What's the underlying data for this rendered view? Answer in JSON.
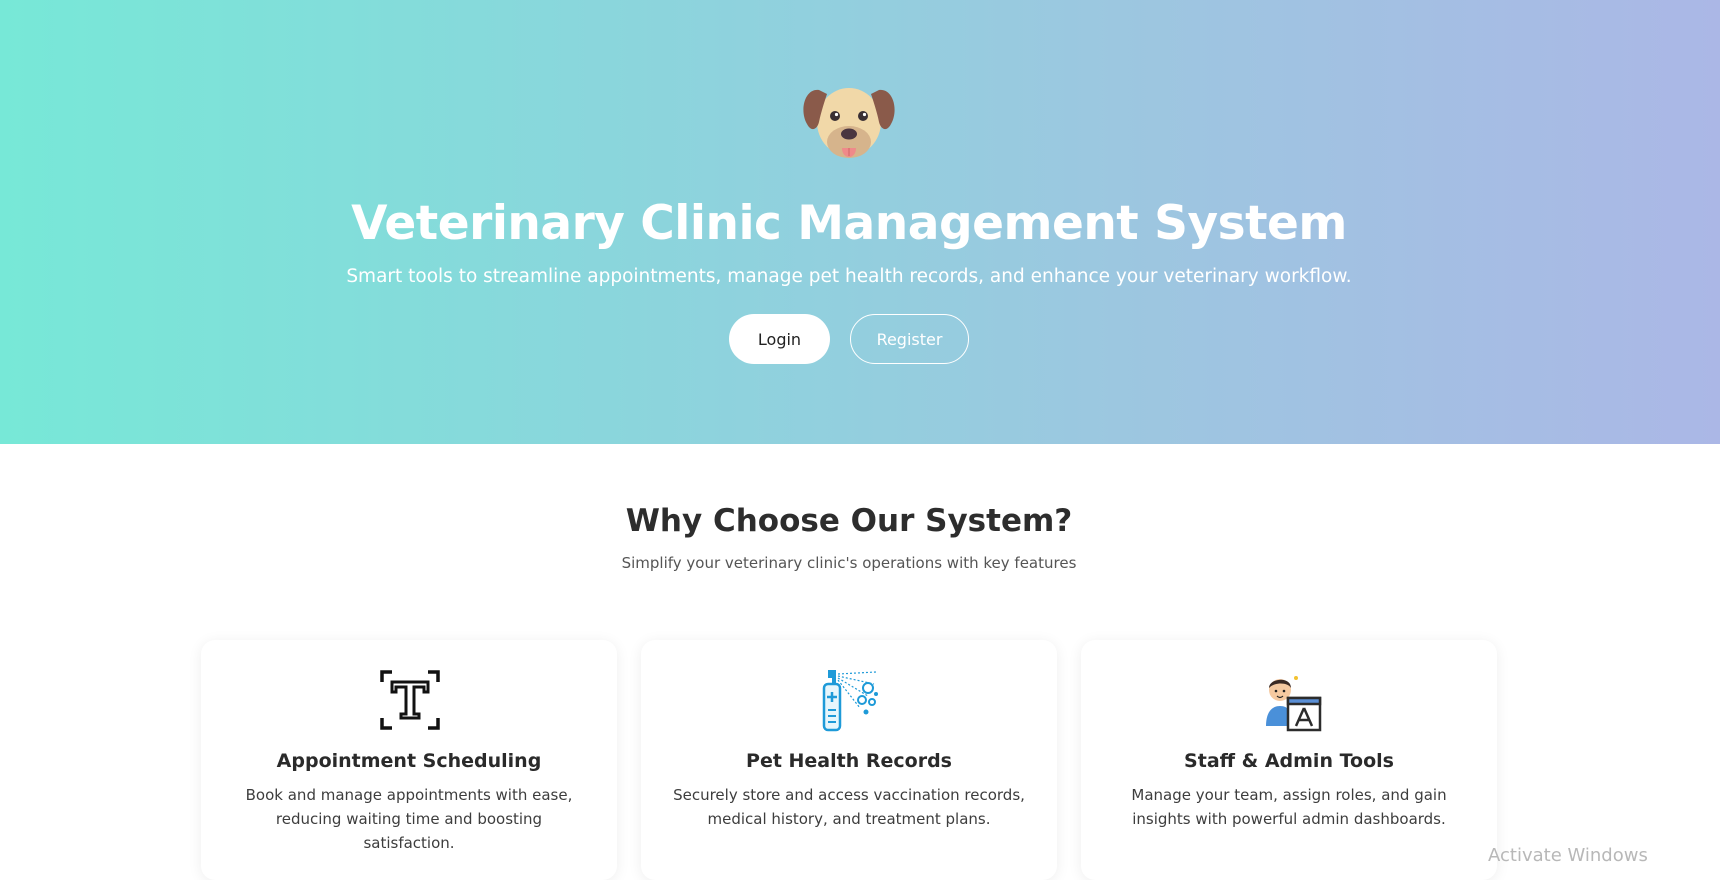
{
  "hero": {
    "logo_icon": "dog-face-icon",
    "title": "Veterinary Clinic Management System",
    "subtitle": "Smart tools to streamline appointments, manage pet health records, and enhance your veterinary workflow.",
    "login_label": "Login",
    "register_label": "Register",
    "gradient_start": "#77e8d7",
    "gradient_end": "#abb7e6"
  },
  "features": {
    "title": "Why Choose Our System?",
    "subtitle": "Simplify your veterinary clinic's operations with key features",
    "cards": [
      {
        "icon": "text-scan-icon",
        "title": "Appointment Scheduling",
        "description": "Book and manage appointments with ease, reducing waiting time and boosting satisfaction."
      },
      {
        "icon": "spray-bottle-icon",
        "title": "Pet Health Records",
        "description": "Securely store and access vaccination records, medical history, and treatment plans."
      },
      {
        "icon": "admin-user-icon",
        "title": "Staff & Admin Tools",
        "description": "Manage your team, assign roles, and gain insights with powerful admin dashboards."
      }
    ]
  },
  "watermark": "Activate Windows"
}
